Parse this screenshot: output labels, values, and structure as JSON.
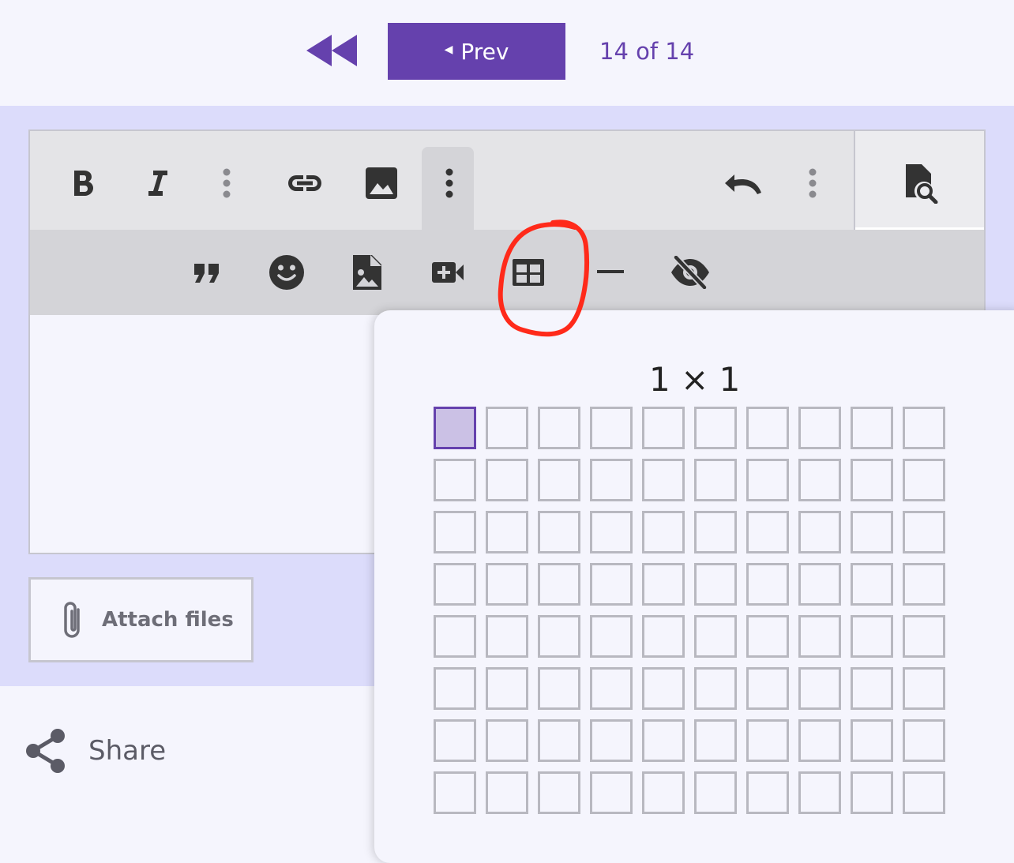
{
  "pager": {
    "prev_label": "Prev",
    "page_indicator": "14 of 14"
  },
  "toolbar": {
    "row1_icons": [
      "bold-icon",
      "italic-icon",
      "more-vertical-icon",
      "link-icon",
      "image-icon",
      "more-vertical-icon",
      "undo-icon",
      "more-vertical-icon"
    ],
    "preview_icon": "preview-search-icon",
    "row2_icons": [
      "quote-icon",
      "emoji-icon",
      "image-file-icon",
      "video-add-icon",
      "table-icon",
      "horizontal-rule-icon",
      "hide-icon"
    ]
  },
  "table_picker": {
    "size_label": "1 × 1",
    "columns": 10,
    "visible_rows": 8,
    "selected": {
      "rows": 1,
      "cols": 1
    }
  },
  "attach": {
    "label": "Attach files"
  },
  "share": {
    "label": "Share"
  },
  "colors": {
    "accent": "#6541ad",
    "band": "#dcdcfb",
    "page": "#f5f5fd",
    "annotation": "#ff2a1a"
  }
}
